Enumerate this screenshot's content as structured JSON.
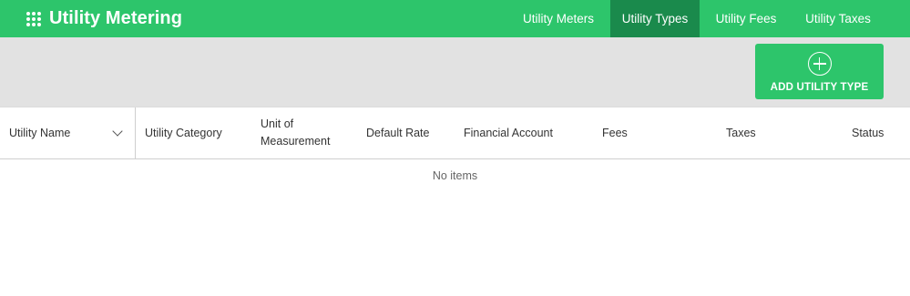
{
  "app": {
    "title": "Utility Metering"
  },
  "nav": {
    "tabs": [
      {
        "label": "Utility Meters",
        "active": false
      },
      {
        "label": "Utility Types",
        "active": true
      },
      {
        "label": "Utility Fees",
        "active": false
      },
      {
        "label": "Utility Taxes",
        "active": false
      }
    ]
  },
  "actions": {
    "add_label": "ADD UTILITY TYPE"
  },
  "table": {
    "columns": [
      "Utility Name",
      "Utility Category",
      "Unit of Measurement",
      "Default Rate",
      "Financial Account",
      "Fees",
      "Taxes",
      "Status"
    ],
    "rows": [],
    "empty_message": "No items"
  },
  "colors": {
    "brand": "#2dc56b",
    "active_tab": "#1a8a4c",
    "toolbar_bg": "#e2e2e2"
  }
}
